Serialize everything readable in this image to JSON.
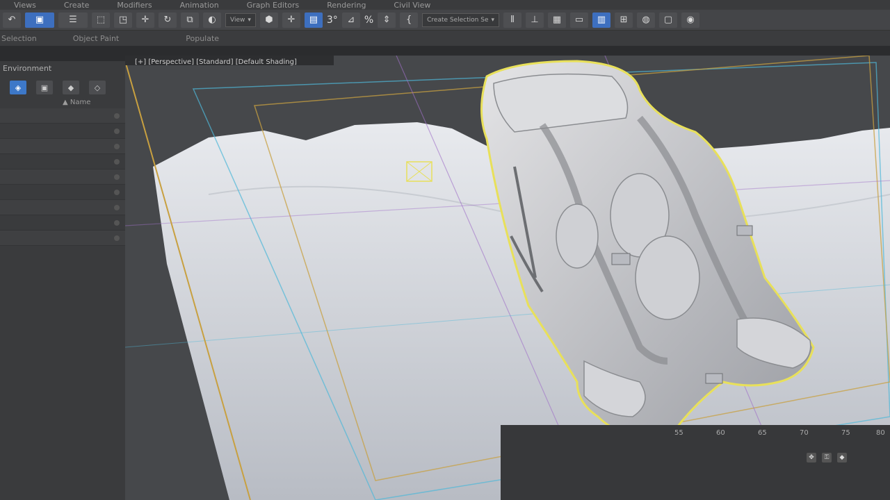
{
  "menu": [
    "Views",
    "Create",
    "Modifiers",
    "Animation",
    "Graph Editors",
    "Rendering",
    "Civil View"
  ],
  "toolbar": {
    "view_dropdown": "View",
    "selection_set": "Create Selection Se",
    "angle_snap": "3°",
    "percent_snap": "%"
  },
  "ribbon": {
    "selection": "Selection",
    "object_paint": "Object Paint",
    "populate": "Populate"
  },
  "left_panel": {
    "title": "Environment",
    "filter_label": "Name",
    "rows": [
      "",
      "",
      "",
      "",
      "",
      "",
      "",
      "",
      ""
    ]
  },
  "viewport": {
    "label": "[+] [Perspective] [Standard] [Default Shading]"
  },
  "timeline": {
    "ticks": [
      "55",
      "60",
      "65",
      "70",
      "75",
      "80"
    ]
  },
  "colors": {
    "selection_outline": "#e8e05a",
    "active_button": "#3d6fbf",
    "safe_frame_orange": "#c8a040",
    "grid_cyan": "#4fb8d8",
    "grid_purple": "#a070c8"
  }
}
